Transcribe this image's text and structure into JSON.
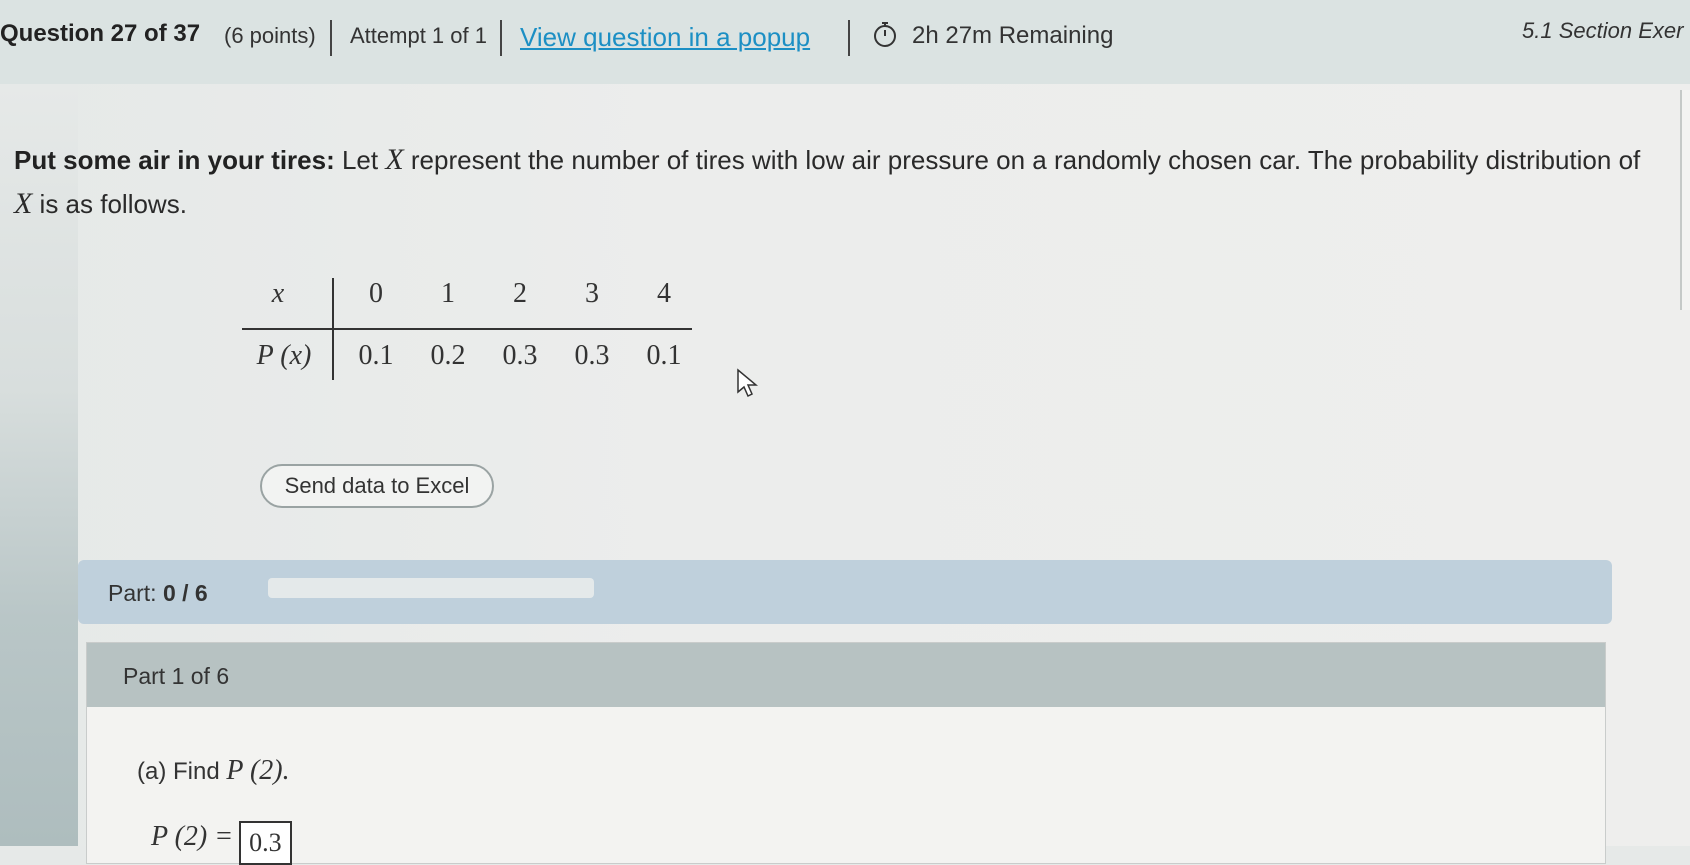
{
  "header": {
    "question": "Question 27 of 37",
    "points": "(6 points)",
    "attempt": "Attempt 1 of 1",
    "popup_link": "View question in a popup",
    "remaining": "2h 27m Remaining",
    "section": "5.1 Section Exer"
  },
  "question": {
    "bold_lead": "Put some air in your tires:",
    "text_1": " Let ",
    "var_1": "X",
    "text_2": " represent the number of tires with low air pressure on a randomly chosen car. The probability distribution of ",
    "var_2": "X",
    "text_3": " is as follows."
  },
  "distribution": {
    "x_label": "x",
    "p_label": "P (x)",
    "x_values": [
      "0",
      "1",
      "2",
      "3",
      "4"
    ],
    "p_values": [
      "0.1",
      "0.2",
      "0.3",
      "0.3",
      "0.1"
    ]
  },
  "excel_button": "Send data to Excel",
  "part_progress": {
    "label": "Part:",
    "value": "0 / 6",
    "fraction": 0
  },
  "part1": {
    "title": "Part 1 of 6",
    "prompt_text": "(a) Find ",
    "prompt_math": "P (2).",
    "answer_lhs": "P (2) =",
    "answer_value": "0.3"
  }
}
